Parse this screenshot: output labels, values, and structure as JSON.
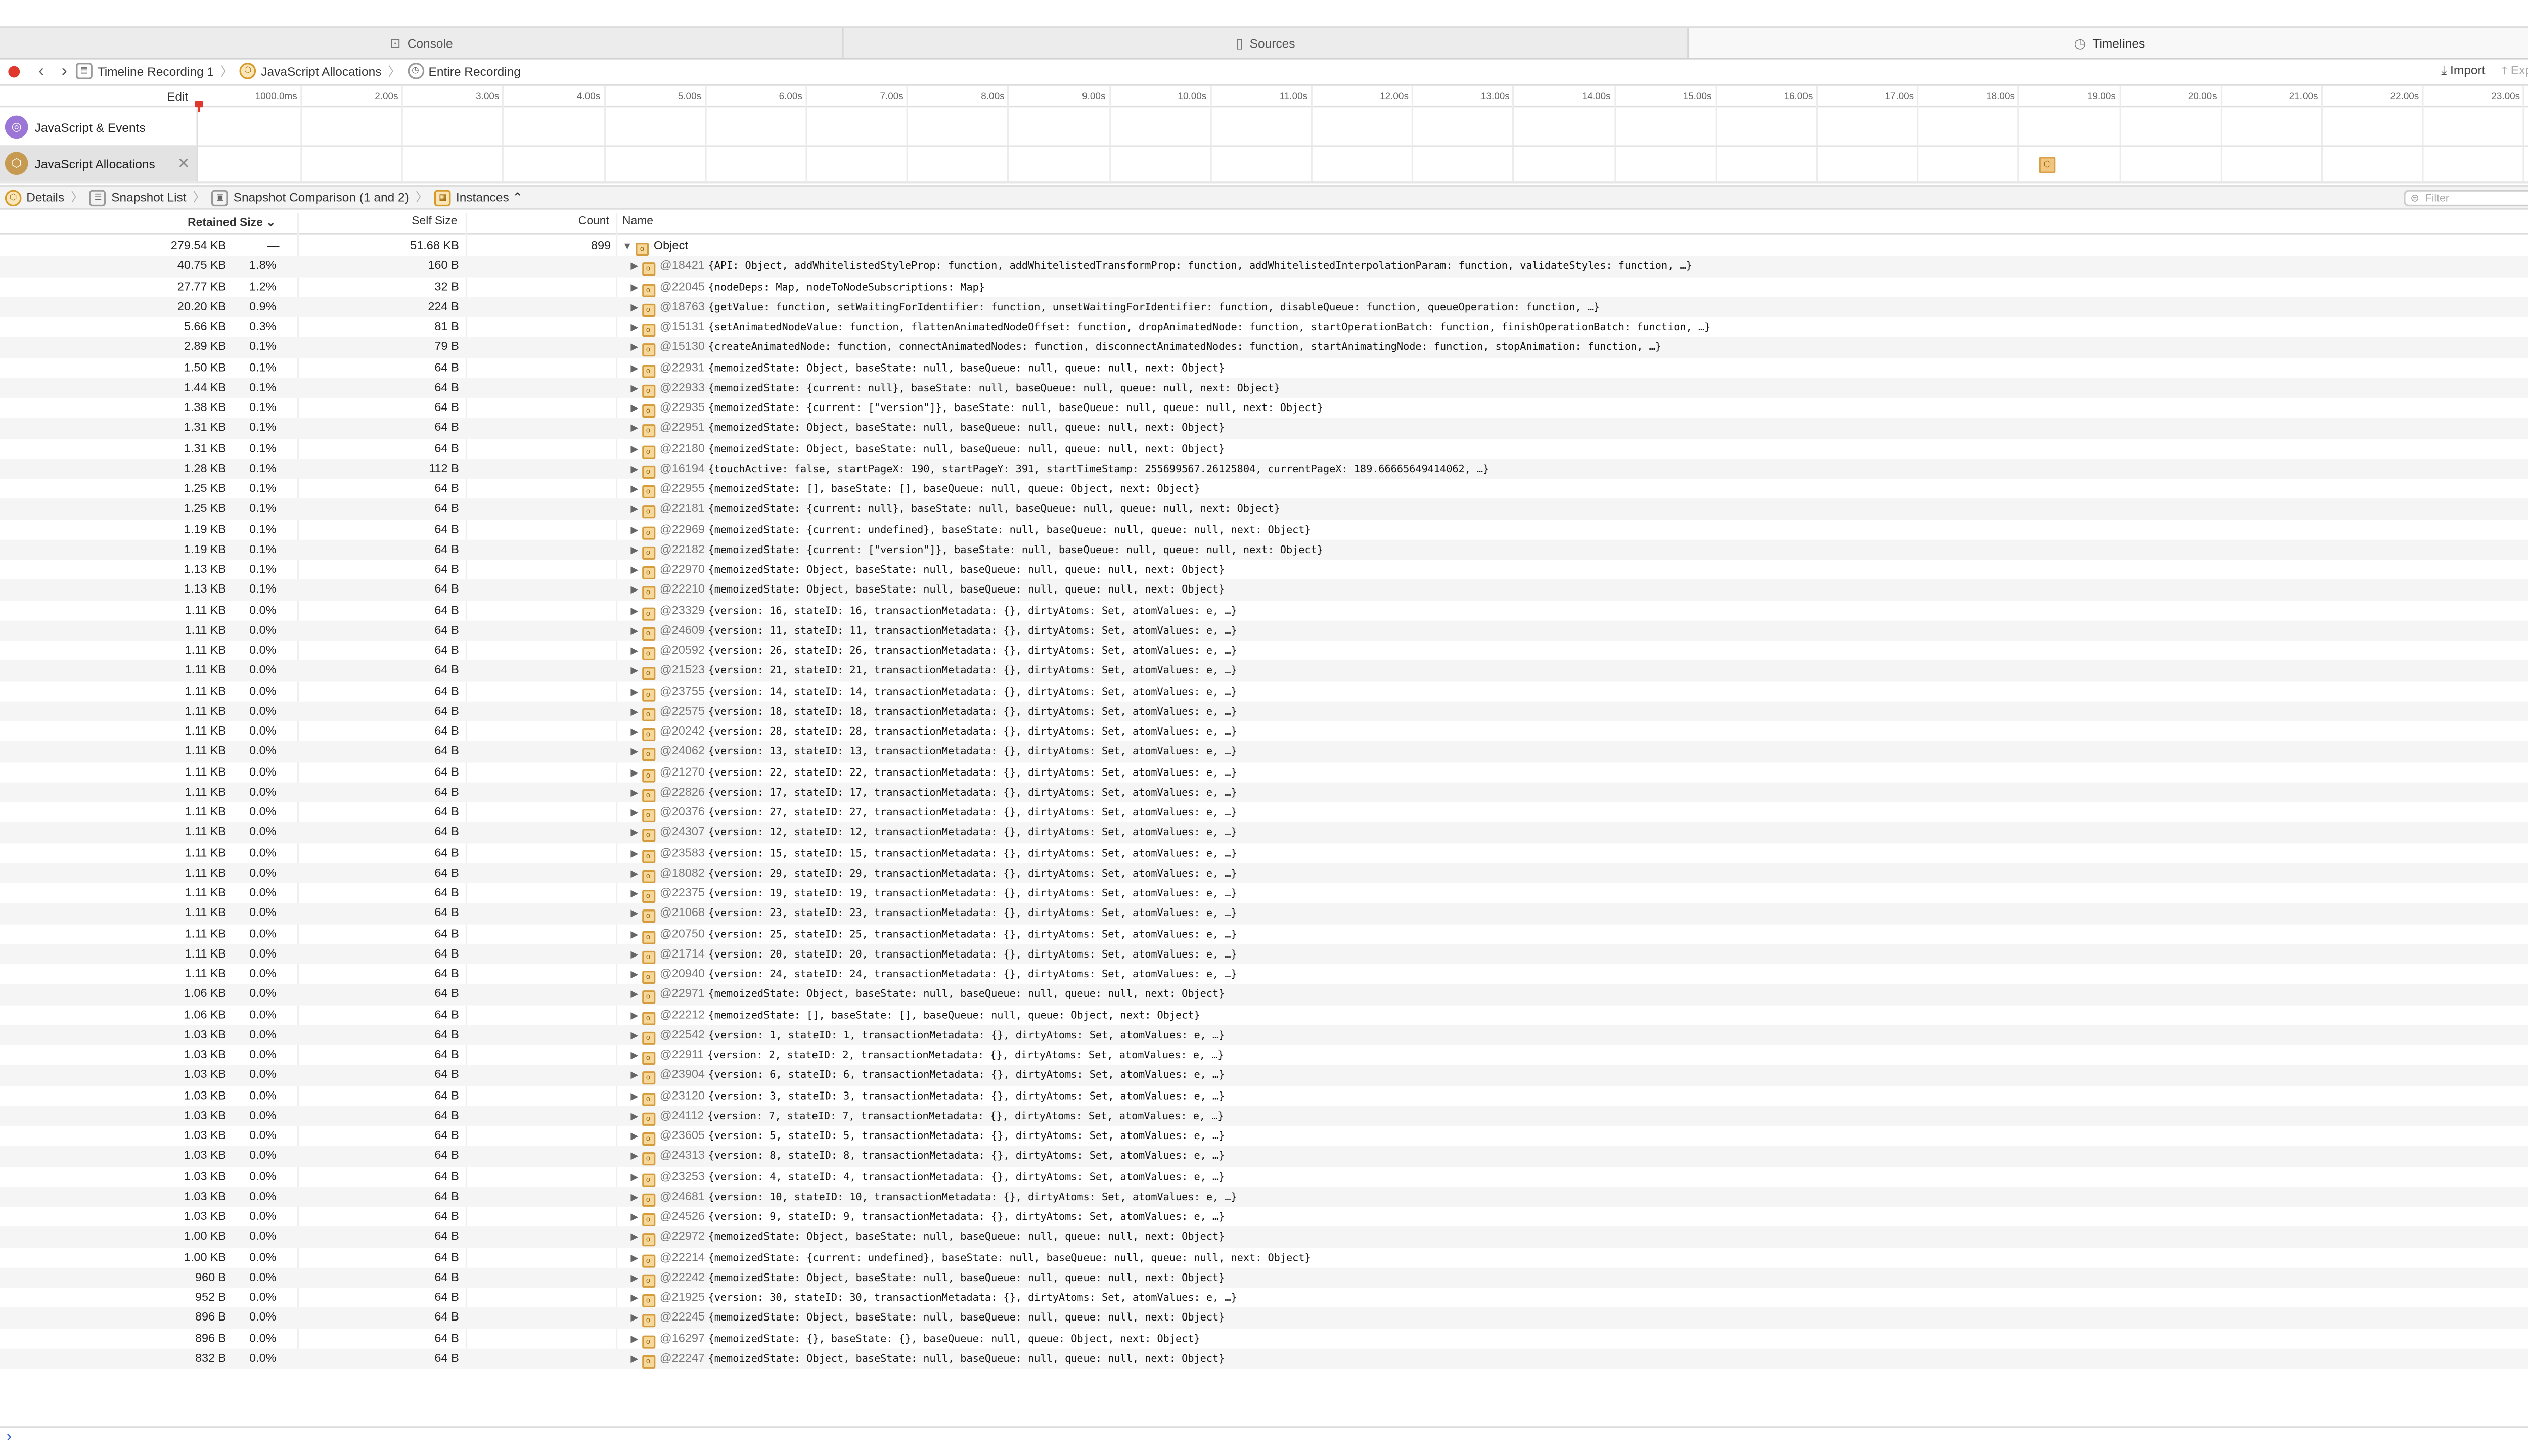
{
  "tabs": [
    {
      "label": "Console",
      "icon": "console-icon",
      "active": false
    },
    {
      "label": "Sources",
      "icon": "document-icon",
      "active": false
    },
    {
      "label": "Timelines",
      "icon": "clock-icon",
      "active": true
    }
  ],
  "breadcrumb": [
    {
      "label": "Timeline Recording 1",
      "icon": "recording-icon"
    },
    {
      "label": "JavaScript Allocations",
      "icon": "allocations-icon"
    },
    {
      "label": "Entire Recording",
      "icon": "clock-icon"
    }
  ],
  "toolbar": {
    "import_label": "Import",
    "export_label": "Export"
  },
  "ruler": {
    "edit_label": "Edit",
    "ticks": [
      "1000.0ms",
      "2.00s",
      "3.00s",
      "4.00s",
      "5.00s",
      "6.00s",
      "7.00s",
      "8.00s",
      "9.00s",
      "10.00s",
      "11.00s",
      "12.00s",
      "13.00s",
      "14.00s",
      "15.00s",
      "16.00s",
      "17.00s",
      "18.00s",
      "19.00s",
      "20.00s",
      "21.00s",
      "22.00s",
      "23.00s"
    ]
  },
  "timeline_rows": [
    {
      "label": "JavaScript & Events",
      "color": "#9b76d6",
      "selected": false
    },
    {
      "label": "JavaScript Allocations",
      "color": "#c79a52",
      "selected": true
    }
  ],
  "content_nav": [
    {
      "label": "Details"
    },
    {
      "label": "Snapshot List"
    },
    {
      "label": "Snapshot Comparison (1 and 2)"
    },
    {
      "label": "Instances ⌃"
    }
  ],
  "filter_placeholder": "Filter",
  "table": {
    "headers": {
      "retained": "Retained Size ⌄",
      "self": "Self Size",
      "count": "Count",
      "name": "Name"
    },
    "root": {
      "retained": "279.54 KB",
      "pct": "—",
      "self": "51.68 KB",
      "count": "899",
      "name": "Object"
    },
    "rows": [
      [
        "40.75 KB",
        "1.8%",
        "160 B",
        "@18421",
        "{API: Object, addWhitelistedStyleProp: function, addWhitelistedTransformProp: function, addWhitelistedInterpolationParam: function, validateStyles: function, …}"
      ],
      [
        "27.77 KB",
        "1.2%",
        "32 B",
        "@22045",
        "{nodeDeps: Map, nodeToNodeSubscriptions: Map}"
      ],
      [
        "20.20 KB",
        "0.9%",
        "224 B",
        "@18763",
        "{getValue: function, setWaitingForIdentifier: function, unsetWaitingForIdentifier: function, disableQueue: function, queueOperation: function, …}"
      ],
      [
        "5.66 KB",
        "0.3%",
        "81 B",
        "@15131",
        "{setAnimatedNodeValue: function, flattenAnimatedNodeOffset: function, dropAnimatedNode: function, startOperationBatch: function, finishOperationBatch: function, …}"
      ],
      [
        "2.89 KB",
        "0.1%",
        "79 B",
        "@15130",
        "{createAnimatedNode: function, connectAnimatedNodes: function, disconnectAnimatedNodes: function, startAnimatingNode: function, stopAnimation: function, …}"
      ],
      [
        "1.50 KB",
        "0.1%",
        "64 B",
        "@22931",
        "{memoizedState: Object, baseState: null, baseQueue: null, queue: null, next: Object}"
      ],
      [
        "1.44 KB",
        "0.1%",
        "64 B",
        "@22933",
        "{memoizedState: {current: null}, baseState: null, baseQueue: null, queue: null, next: Object}"
      ],
      [
        "1.38 KB",
        "0.1%",
        "64 B",
        "@22935",
        "{memoizedState: {current: [\"version\"]}, baseState: null, baseQueue: null, queue: null, next: Object}"
      ],
      [
        "1.31 KB",
        "0.1%",
        "64 B",
        "@22951",
        "{memoizedState: Object, baseState: null, baseQueue: null, queue: null, next: Object}"
      ],
      [
        "1.31 KB",
        "0.1%",
        "64 B",
        "@22180",
        "{memoizedState: Object, baseState: null, baseQueue: null, queue: null, next: Object}"
      ],
      [
        "1.28 KB",
        "0.1%",
        "112 B",
        "@16194",
        "{touchActive: false, startPageX: 190, startPageY: 391, startTimeStamp: 255699567.26125804, currentPageX: 189.66665649414062, …}"
      ],
      [
        "1.25 KB",
        "0.1%",
        "64 B",
        "@22955",
        "{memoizedState: [], baseState: [], baseQueue: null, queue: Object, next: Object}"
      ],
      [
        "1.25 KB",
        "0.1%",
        "64 B",
        "@22181",
        "{memoizedState: {current: null}, baseState: null, baseQueue: null, queue: null, next: Object}"
      ],
      [
        "1.19 KB",
        "0.1%",
        "64 B",
        "@22969",
        "{memoizedState: {current: undefined}, baseState: null, baseQueue: null, queue: null, next: Object}"
      ],
      [
        "1.19 KB",
        "0.1%",
        "64 B",
        "@22182",
        "{memoizedState: {current: [\"version\"]}, baseState: null, baseQueue: null, queue: null, next: Object}"
      ],
      [
        "1.13 KB",
        "0.1%",
        "64 B",
        "@22970",
        "{memoizedState: Object, baseState: null, baseQueue: null, queue: null, next: Object}"
      ],
      [
        "1.13 KB",
        "0.1%",
        "64 B",
        "@22210",
        "{memoizedState: Object, baseState: null, baseQueue: null, queue: null, next: Object}"
      ],
      [
        "1.11 KB",
        "0.0%",
        "64 B",
        "@23329",
        "{version: 16, stateID: 16, transactionMetadata: {}, dirtyAtoms: Set, atomValues: e, …}"
      ],
      [
        "1.11 KB",
        "0.0%",
        "64 B",
        "@24609",
        "{version: 11, stateID: 11, transactionMetadata: {}, dirtyAtoms: Set, atomValues: e, …}"
      ],
      [
        "1.11 KB",
        "0.0%",
        "64 B",
        "@20592",
        "{version: 26, stateID: 26, transactionMetadata: {}, dirtyAtoms: Set, atomValues: e, …}"
      ],
      [
        "1.11 KB",
        "0.0%",
        "64 B",
        "@21523",
        "{version: 21, stateID: 21, transactionMetadata: {}, dirtyAtoms: Set, atomValues: e, …}"
      ],
      [
        "1.11 KB",
        "0.0%",
        "64 B",
        "@23755",
        "{version: 14, stateID: 14, transactionMetadata: {}, dirtyAtoms: Set, atomValues: e, …}"
      ],
      [
        "1.11 KB",
        "0.0%",
        "64 B",
        "@22575",
        "{version: 18, stateID: 18, transactionMetadata: {}, dirtyAtoms: Set, atomValues: e, …}"
      ],
      [
        "1.11 KB",
        "0.0%",
        "64 B",
        "@20242",
        "{version: 28, stateID: 28, transactionMetadata: {}, dirtyAtoms: Set, atomValues: e, …}"
      ],
      [
        "1.11 KB",
        "0.0%",
        "64 B",
        "@24062",
        "{version: 13, stateID: 13, transactionMetadata: {}, dirtyAtoms: Set, atomValues: e, …}"
      ],
      [
        "1.11 KB",
        "0.0%",
        "64 B",
        "@21270",
        "{version: 22, stateID: 22, transactionMetadata: {}, dirtyAtoms: Set, atomValues: e, …}"
      ],
      [
        "1.11 KB",
        "0.0%",
        "64 B",
        "@22826",
        "{version: 17, stateID: 17, transactionMetadata: {}, dirtyAtoms: Set, atomValues: e, …}"
      ],
      [
        "1.11 KB",
        "0.0%",
        "64 B",
        "@20376",
        "{version: 27, stateID: 27, transactionMetadata: {}, dirtyAtoms: Set, atomValues: e, …}"
      ],
      [
        "1.11 KB",
        "0.0%",
        "64 B",
        "@24307",
        "{version: 12, stateID: 12, transactionMetadata: {}, dirtyAtoms: Set, atomValues: e, …}"
      ],
      [
        "1.11 KB",
        "0.0%",
        "64 B",
        "@23583",
        "{version: 15, stateID: 15, transactionMetadata: {}, dirtyAtoms: Set, atomValues: e, …}"
      ],
      [
        "1.11 KB",
        "0.0%",
        "64 B",
        "@18082",
        "{version: 29, stateID: 29, transactionMetadata: {}, dirtyAtoms: Set, atomValues: e, …}"
      ],
      [
        "1.11 KB",
        "0.0%",
        "64 B",
        "@22375",
        "{version: 19, stateID: 19, transactionMetadata: {}, dirtyAtoms: Set, atomValues: e, …}"
      ],
      [
        "1.11 KB",
        "0.0%",
        "64 B",
        "@21068",
        "{version: 23, stateID: 23, transactionMetadata: {}, dirtyAtoms: Set, atomValues: e, …}"
      ],
      [
        "1.11 KB",
        "0.0%",
        "64 B",
        "@20750",
        "{version: 25, stateID: 25, transactionMetadata: {}, dirtyAtoms: Set, atomValues: e, …}"
      ],
      [
        "1.11 KB",
        "0.0%",
        "64 B",
        "@21714",
        "{version: 20, stateID: 20, transactionMetadata: {}, dirtyAtoms: Set, atomValues: e, …}"
      ],
      [
        "1.11 KB",
        "0.0%",
        "64 B",
        "@20940",
        "{version: 24, stateID: 24, transactionMetadata: {}, dirtyAtoms: Set, atomValues: e, …}"
      ],
      [
        "1.06 KB",
        "0.0%",
        "64 B",
        "@22971",
        "{memoizedState: Object, baseState: null, baseQueue: null, queue: null, next: Object}"
      ],
      [
        "1.06 KB",
        "0.0%",
        "64 B",
        "@22212",
        "{memoizedState: [], baseState: [], baseQueue: null, queue: Object, next: Object}"
      ],
      [
        "1.03 KB",
        "0.0%",
        "64 B",
        "@22542",
        "{version: 1, stateID: 1, transactionMetadata: {}, dirtyAtoms: Set, atomValues: e, …}"
      ],
      [
        "1.03 KB",
        "0.0%",
        "64 B",
        "@22911",
        "{version: 2, stateID: 2, transactionMetadata: {}, dirtyAtoms: Set, atomValues: e, …}"
      ],
      [
        "1.03 KB",
        "0.0%",
        "64 B",
        "@23904",
        "{version: 6, stateID: 6, transactionMetadata: {}, dirtyAtoms: Set, atomValues: e, …}"
      ],
      [
        "1.03 KB",
        "0.0%",
        "64 B",
        "@23120",
        "{version: 3, stateID: 3, transactionMetadata: {}, dirtyAtoms: Set, atomValues: e, …}"
      ],
      [
        "1.03 KB",
        "0.0%",
        "64 B",
        "@24112",
        "{version: 7, stateID: 7, transactionMetadata: {}, dirtyAtoms: Set, atomValues: e, …}"
      ],
      [
        "1.03 KB",
        "0.0%",
        "64 B",
        "@23605",
        "{version: 5, stateID: 5, transactionMetadata: {}, dirtyAtoms: Set, atomValues: e, …}"
      ],
      [
        "1.03 KB",
        "0.0%",
        "64 B",
        "@24313",
        "{version: 8, stateID: 8, transactionMetadata: {}, dirtyAtoms: Set, atomValues: e, …}"
      ],
      [
        "1.03 KB",
        "0.0%",
        "64 B",
        "@23253",
        "{version: 4, stateID: 4, transactionMetadata: {}, dirtyAtoms: Set, atomValues: e, …}"
      ],
      [
        "1.03 KB",
        "0.0%",
        "64 B",
        "@24681",
        "{version: 10, stateID: 10, transactionMetadata: {}, dirtyAtoms: Set, atomValues: e, …}"
      ],
      [
        "1.03 KB",
        "0.0%",
        "64 B",
        "@24526",
        "{version: 9, stateID: 9, transactionMetadata: {}, dirtyAtoms: Set, atomValues: e, …}"
      ],
      [
        "1.00 KB",
        "0.0%",
        "64 B",
        "@22972",
        "{memoizedState: Object, baseState: null, baseQueue: null, queue: null, next: Object}"
      ],
      [
        "1.00 KB",
        "0.0%",
        "64 B",
        "@22214",
        "{memoizedState: {current: undefined}, baseState: null, baseQueue: null, queue: null, next: Object}"
      ],
      [
        "960 B",
        "0.0%",
        "64 B",
        "@22242",
        "{memoizedState: Object, baseState: null, baseQueue: null, queue: null, next: Object}"
      ],
      [
        "952 B",
        "0.0%",
        "64 B",
        "@21925",
        "{version: 30, stateID: 30, transactionMetadata: {}, dirtyAtoms: Set, atomValues: e, …}"
      ],
      [
        "896 B",
        "0.0%",
        "64 B",
        "@22245",
        "{memoizedState: Object, baseState: null, baseQueue: null, queue: null, next: Object}"
      ],
      [
        "896 B",
        "0.0%",
        "64 B",
        "@16297",
        "{memoizedState: {}, baseState: {}, baseQueue: null, queue: Object, next: Object}"
      ],
      [
        "832 B",
        "0.0%",
        "64 B",
        "@22247",
        "{memoizedState: Object, baseState: null, baseQueue: null, queue: null, next: Object}"
      ]
    ]
  },
  "console_prompt": "›"
}
